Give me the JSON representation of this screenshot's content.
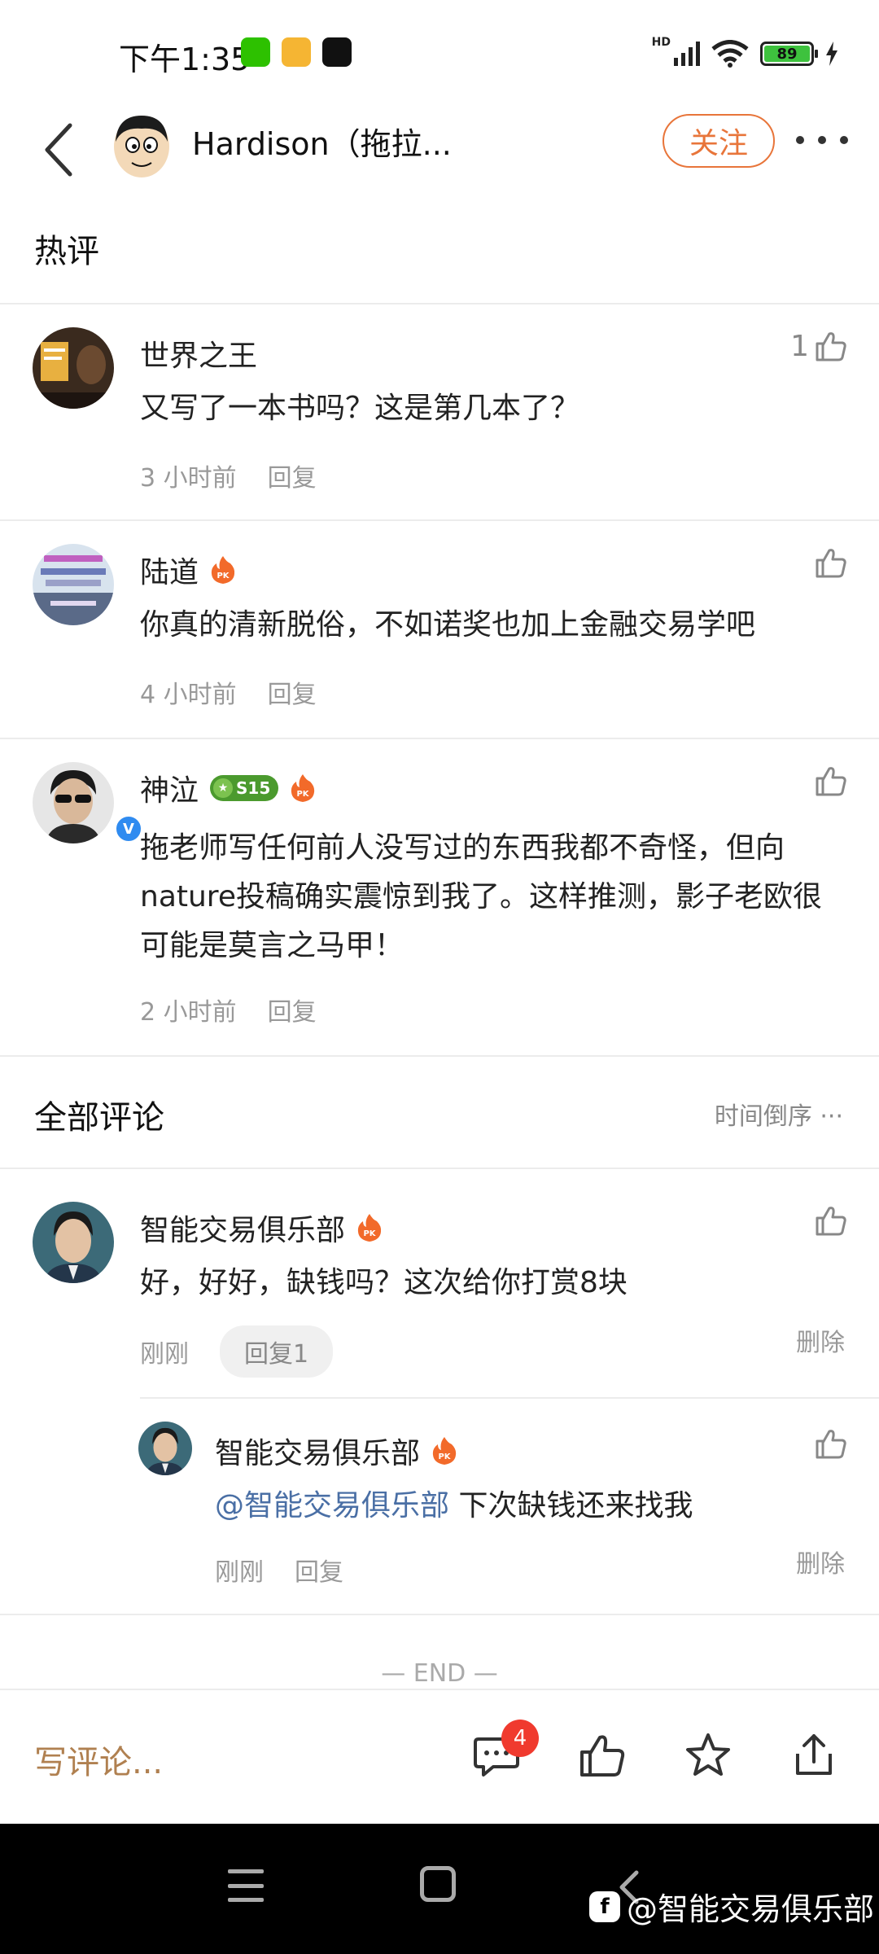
{
  "status_bar": {
    "time": "下午1:35",
    "network_label": "HD",
    "battery": "89",
    "battery_level_percent": 89
  },
  "header": {
    "title": "Hardison（拖拉...",
    "follow_label": "关注"
  },
  "hot_comments": {
    "title": "热评",
    "items": [
      {
        "name": "世界之王",
        "text": "又写了一本书吗？这是第几本了？",
        "time": "3 小时前",
        "reply_label": "回复",
        "likes": "1",
        "badges": []
      },
      {
        "name": "陆道",
        "text": "你真的清新脱俗，不如诺奖也加上金融交易学吧",
        "time": "4 小时前",
        "reply_label": "回复",
        "likes": "",
        "badges": [
          "pk"
        ]
      },
      {
        "name": "神泣",
        "text": "拖老师写任何前人没写过的东西我都不奇怪，但向nature投稿确实震惊到我了。这样推测，影子老欧很可能是莫言之马甲！",
        "time": "2 小时前",
        "reply_label": "回复",
        "likes": "",
        "level": "S15",
        "badges": [
          "level",
          "pk"
        ],
        "verified": true
      }
    ]
  },
  "all_comments": {
    "title": "全部评论",
    "sort_label": "时间倒序",
    "items": [
      {
        "name": "智能交易俱乐部",
        "text": "好，好好，缺钱吗？这次给你打赏8块",
        "time": "刚刚",
        "reply_label": "回复1",
        "delete_label": "删除",
        "sub_reply": {
          "name": "智能交易俱乐部",
          "mention": "@智能交易俱乐部",
          "text": " 下次缺钱还来找我",
          "time": "刚刚",
          "reply_label": "回复",
          "delete_label": "删除"
        }
      }
    ],
    "end_label": "— END —"
  },
  "bottom_bar": {
    "write_placeholder": "写评论...",
    "comment_count": "4"
  },
  "watermark": {
    "logo": "f",
    "text": "@智能交易俱乐部"
  },
  "colors": {
    "accent": "#e8753a",
    "mention": "#4a6fa5",
    "badge_red": "#f03a2e",
    "write_comment": "#b08050"
  },
  "icons": [
    "wechat-icon",
    "notes-icon",
    "tiktok-icon",
    "signal-icon",
    "wifi-icon",
    "battery-icon",
    "charging-icon",
    "back-icon",
    "more-icon",
    "thumb-up-icon",
    "pk-badge-icon",
    "verified-icon",
    "comment-icon",
    "star-icon",
    "share-icon"
  ]
}
